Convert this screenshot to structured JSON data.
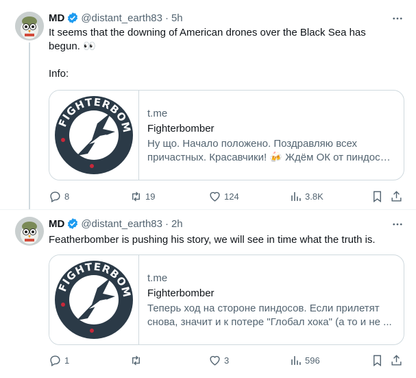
{
  "tweets": [
    {
      "name": "MD",
      "handle": "@distant_earth83",
      "dot": "·",
      "time": "5h",
      "text": "It seems that the downing of American drones over the Black Sea has\nbegun. 👀\n\nInfo:",
      "card": {
        "domain": "t.me",
        "title": "Fighterbomber",
        "desc_line1": "Ну що. Начало положено. Поздравляю всех",
        "desc_line2": "причастных. Красавчики! 🍻 Ждём ОК от пиндосо..."
      },
      "actions": {
        "reply": "8",
        "retweet": "19",
        "like": "124",
        "views": "3.8K"
      }
    },
    {
      "name": "MD",
      "handle": "@distant_earth83",
      "dot": "·",
      "time": "2h",
      "text": "Featherbomber is pushing his story, we will see in time what the truth is.",
      "card": {
        "domain": "t.me",
        "title": "Fighterbomber",
        "desc_line1": "Теперь ход на стороне пиндосов. Если прилетят",
        "desc_line2": "снова, значит и к потере \"Глобал хока\" (а то и не ..."
      },
      "actions": {
        "reply": "1",
        "retweet": "",
        "like": "3",
        "views": "596"
      }
    }
  ],
  "logo": {
    "text": "FIGHTERBOMBER",
    "color": "#2b3a47"
  },
  "icons": [
    "verified-badge-icon",
    "more-icon",
    "reply-icon",
    "retweet-icon",
    "like-icon",
    "views-icon",
    "bookmark-icon",
    "share-icon"
  ],
  "colors": {
    "verified": "#1d9bf0",
    "secondary_text": "#536471",
    "border": "#cfd9de"
  }
}
